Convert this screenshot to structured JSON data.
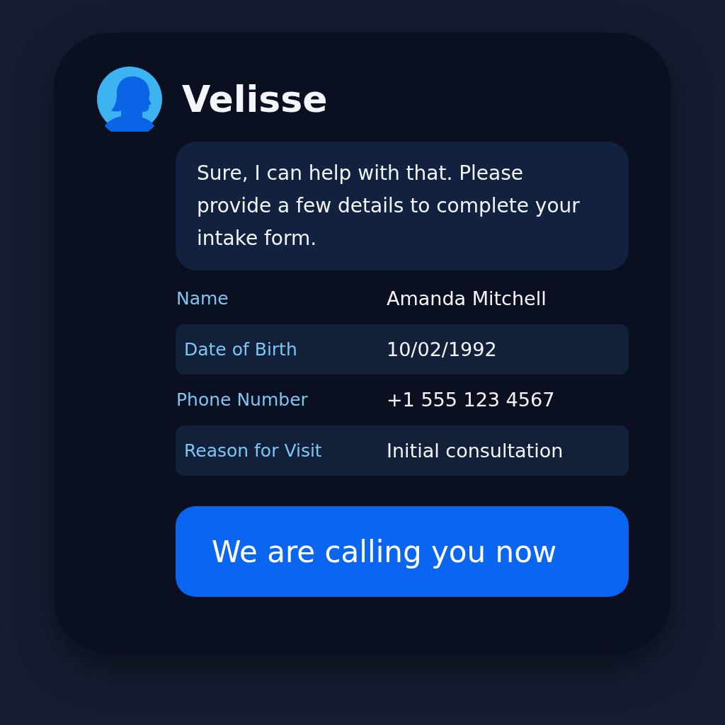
{
  "assistant": {
    "name": "Velisse"
  },
  "message": "Sure, I can help with that. Please provide a few details to complete your intake form.",
  "fields": [
    {
      "label": "Name",
      "value": "Amanda Mitchell"
    },
    {
      "label": "Date of Birth",
      "value": "10/02/1992"
    },
    {
      "label": "Phone Number",
      "value": "+1 555 123 4567"
    },
    {
      "label": "Reason for Visit",
      "value": "Initial consultation"
    }
  ],
  "button": {
    "label": "We are calling you now"
  }
}
